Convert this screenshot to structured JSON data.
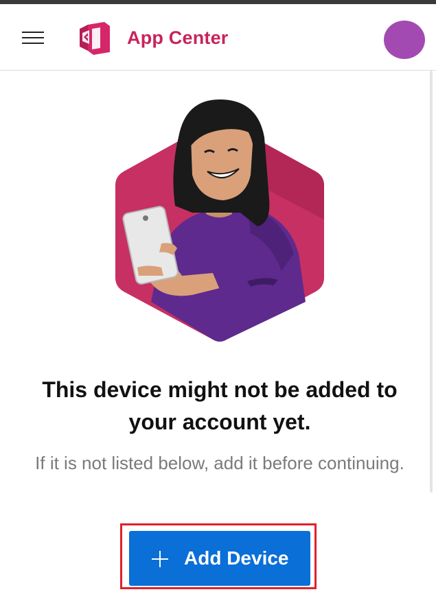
{
  "header": {
    "brand": "App Center",
    "menu_icon": "hamburger-icon",
    "logo_icon": "app-center-logo-icon",
    "avatar_color": "#a24ab2",
    "brand_color": "#c8235a"
  },
  "main": {
    "illustration": "person-holding-phone-illustration",
    "headline": "This device might not be added to your account yet.",
    "subtext": "If it is not listed below, add it before continuing.",
    "add_button": {
      "icon": "plus-icon",
      "label": "Add Device",
      "color": "#0a6fd6"
    }
  }
}
